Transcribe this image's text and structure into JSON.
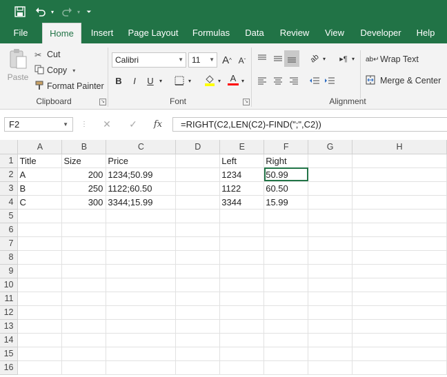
{
  "qat": {
    "save_icon": "save-icon",
    "undo_icon": "undo-icon",
    "redo_icon": "redo-icon",
    "customize_icon": "customize-qat-icon"
  },
  "tabs": [
    "File",
    "Home",
    "Insert",
    "Page Layout",
    "Formulas",
    "Data",
    "Review",
    "View",
    "Developer",
    "Help"
  ],
  "active_tab": "Home",
  "ribbon": {
    "clipboard": {
      "paste": "Paste",
      "cut": "Cut",
      "copy": "Copy",
      "format_painter": "Format Painter",
      "label": "Clipboard"
    },
    "font": {
      "font_name": "Calibri",
      "font_size": "11",
      "bold": "B",
      "italic": "I",
      "underline": "U",
      "grow": "A",
      "shrink": "A",
      "font_color_letter": "A",
      "label": "Font"
    },
    "alignment": {
      "wrap_text": "Wrap Text",
      "merge_center": "Merge & Center",
      "label": "Alignment"
    }
  },
  "formula_bar": {
    "name_box": "F2",
    "fx": "fx",
    "formula": "=RIGHT(C2,LEN(C2)-FIND(\";\",C2))"
  },
  "grid": {
    "columns": [
      "A",
      "B",
      "C",
      "D",
      "E",
      "F",
      "G",
      "H"
    ],
    "rows": [
      [
        "Title",
        "Size",
        "Price",
        "",
        "Left",
        "Right",
        "",
        ""
      ],
      [
        "A",
        "200",
        "1234;50.99",
        "",
        "1234",
        "50.99",
        "",
        ""
      ],
      [
        "B",
        "250",
        "1122;60.50",
        "",
        "1122",
        "60.50",
        "",
        ""
      ],
      [
        "C",
        "300",
        "3344;15.99",
        "",
        "3344",
        "15.99",
        "",
        ""
      ],
      [
        "",
        "",
        "",
        "",
        "",
        "",
        "",
        ""
      ],
      [
        "",
        "",
        "",
        "",
        "",
        "",
        "",
        ""
      ],
      [
        "",
        "",
        "",
        "",
        "",
        "",
        "",
        ""
      ],
      [
        "",
        "",
        "",
        "",
        "",
        "",
        "",
        ""
      ],
      [
        "",
        "",
        "",
        "",
        "",
        "",
        "",
        ""
      ],
      [
        "",
        "",
        "",
        "",
        "",
        "",
        "",
        ""
      ],
      [
        "",
        "",
        "",
        "",
        "",
        "",
        "",
        ""
      ],
      [
        "",
        "",
        "",
        "",
        "",
        "",
        "",
        ""
      ],
      [
        "",
        "",
        "",
        "",
        "",
        "",
        "",
        ""
      ],
      [
        "",
        "",
        "",
        "",
        "",
        "",
        "",
        ""
      ],
      [
        "",
        "",
        "",
        "",
        "",
        "",
        "",
        ""
      ],
      [
        "",
        "",
        "",
        "",
        "",
        "",
        "",
        ""
      ]
    ],
    "row_numbers": [
      "1",
      "2",
      "3",
      "4",
      "5",
      "6",
      "7",
      "8",
      "9",
      "10",
      "11",
      "12",
      "13",
      "14",
      "15",
      "16"
    ]
  },
  "colors": {
    "brand": "#217346",
    "highlight": "#ffff00",
    "font_color": "#ff0000"
  }
}
